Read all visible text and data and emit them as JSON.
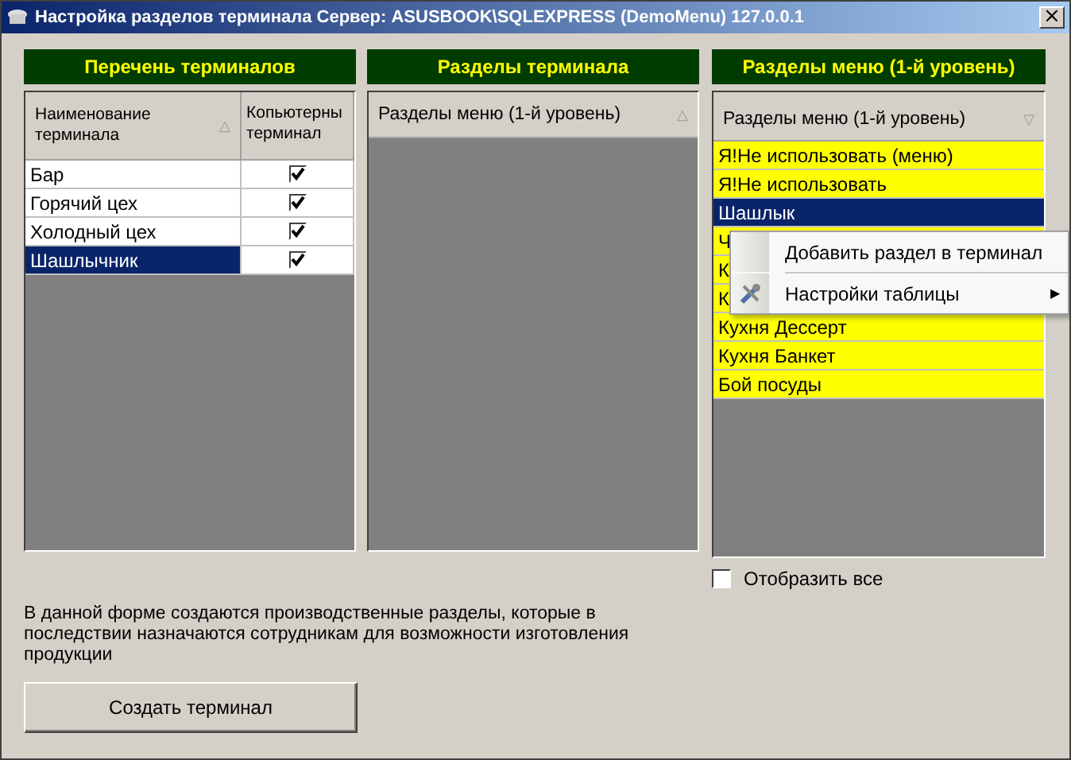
{
  "window": {
    "title": "Настройка разделов терминала  Сервер: ASUSBOOK\\SQLEXPRESS (DemoMenu) 127.0.0.1",
    "close": "×"
  },
  "terminals": {
    "header": "Перечень терминалов",
    "columns": [
      "Наименование терминала",
      "Копьютерны терминал"
    ],
    "sort_mark": "△",
    "rows": [
      {
        "name": "Бар",
        "checked": true,
        "selected": false
      },
      {
        "name": "Горячий цех",
        "checked": true,
        "selected": false
      },
      {
        "name": "Холодный цех",
        "checked": true,
        "selected": false
      },
      {
        "name": "Шашлычник",
        "checked": true,
        "selected": true
      }
    ]
  },
  "sections": {
    "header": "Разделы терминала",
    "column": "Разделы меню (1-й уровень)",
    "sort_mark": "△"
  },
  "menu_sections": {
    "header": "Разделы меню (1-й уровень)",
    "column": "Разделы меню (1-й уровень)",
    "sort_mark": "▽",
    "rows": [
      {
        "name": "Я!Не использовать (меню)",
        "selected": false
      },
      {
        "name": "Я!Не использовать",
        "selected": false
      },
      {
        "name": "Шашлык",
        "selected": true
      },
      {
        "name": "Ч",
        "selected": false
      },
      {
        "name": "К",
        "selected": false
      },
      {
        "name": "К",
        "selected": false
      },
      {
        "name": "Кухня Дессерт",
        "selected": false
      },
      {
        "name": "Кухня Банкет",
        "selected": false
      },
      {
        "name": "Бой посуды",
        "selected": false
      }
    ]
  },
  "show_all": {
    "label": "Отобразить все",
    "checked": false
  },
  "description": "В данной форме создаются производственные разделы, которые в последствии назначаются сотрудникам для возможности изготовления продукции",
  "create_button": "Создать терминал",
  "context_menu": [
    {
      "label": "Добавить раздел в терминал",
      "icon": false,
      "submenu": false
    },
    {
      "label": "Настройки таблицы",
      "icon": true,
      "submenu": true
    }
  ],
  "submenu_arrow": "▶"
}
